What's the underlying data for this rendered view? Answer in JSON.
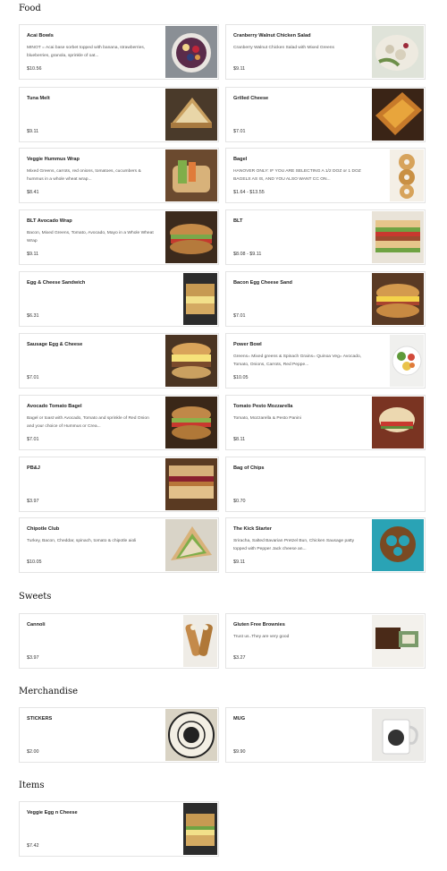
{
  "sections": {
    "food": "Food",
    "sweets": "Sweets",
    "merchandise": "Merchandise",
    "items": "Items"
  },
  "items": {
    "acai": {
      "name": "Acai Bowls",
      "desc": "MINOT = Acai base sorbet topped with banana, strawberries, blueberries, granola, sprinkle of oat...",
      "price": "$10.56"
    },
    "cranberry": {
      "name": "Cranberry Walnut Chicken Salad",
      "desc": "Cranberry Walnut Chicken Salad with Mixed Greens",
      "price": "$9.11"
    },
    "tuna": {
      "name": "Tuna Melt",
      "desc": "",
      "price": "$9.11"
    },
    "grilled": {
      "name": "Grilled Cheese",
      "desc": "",
      "price": "$7.01"
    },
    "hummus": {
      "name": "Veggie Hummus Wrap",
      "desc": "Mixed Greens, carrots, red onions, tomatoes, cucumbers & hummus in a whole wheat wrap...",
      "price": "$8.41"
    },
    "bagel": {
      "name": "Bagel",
      "desc": "HANOVER ONLY: IF YOU ARE SELECTING A 1/2 DOZ or 1 DOZ BAGELS AS IS, AND YOU ALSO WANT CC ON...",
      "price": "$1.64 - $13.55"
    },
    "blt_avocado": {
      "name": "BLT Avocado Wrap",
      "desc": "Bacon, Mixed Greens, Tomato, Avocado, Mayo in a Whole Wheat Wrap",
      "price": "$9.11"
    },
    "blt": {
      "name": "BLT",
      "desc": "",
      "price": "$8.08 - $9.11"
    },
    "egg_cheese": {
      "name": "Egg & Cheese Sandwich",
      "desc": "",
      "price": "$6.31"
    },
    "bacon_egg": {
      "name": "Bacon Egg Cheese Sand",
      "desc": "",
      "price": "$7.01"
    },
    "sausage": {
      "name": "Sausage Egg & Cheese",
      "desc": "",
      "price": "$7.01"
    },
    "power": {
      "name": "Power Bowl",
      "desc": "Greens= Mixed greens & Spinach Grains= Quinoa Veg= Avocado, Tomato, Onions, Carrots, Red Peppe...",
      "price": "$10.05"
    },
    "avocado_bagel": {
      "name": "Avocado Tomato Bagel",
      "desc": "Bagel or toast with Avocado, Tomato and sprinkle of Red Onion and your choice of Hummus or Crea...",
      "price": "$7.01"
    },
    "pesto": {
      "name": "Tomato Pesto Mozzarella",
      "desc": "Tomato, Mozzarella & Pesto Panini",
      "price": "$8.11"
    },
    "pbj": {
      "name": "PB&J",
      "desc": "",
      "price": "$3.97"
    },
    "chips": {
      "name": "Bag of Chips",
      "desc": "",
      "price": "$0.70"
    },
    "chipotle": {
      "name": "Chipotle Club",
      "desc": "Turkey, Bacon, Cheddar, spinach, tomato & chipotle aioli",
      "price": "$10.05"
    },
    "kick": {
      "name": "The Kick Starter",
      "desc": "Sriracha, Salted Bavarian Pretzel Bun, Chicken Sausage patty topped with Pepper Jack cheese an...",
      "price": "$9.11"
    },
    "cannoli": {
      "name": "Cannoli",
      "desc": "",
      "price": "$3.97"
    },
    "brownies": {
      "name": "Gluten Free Brownies",
      "desc": "Trust us..They are very good",
      "price": "$3.27"
    },
    "stickers": {
      "name": "STICKERS",
      "desc": "",
      "price": "$2.00"
    },
    "mug": {
      "name": "MUG",
      "desc": "",
      "price": "$9.90"
    },
    "veggie_egg": {
      "name": "Veggie Egg n Cheese",
      "desc": "",
      "price": "$7.42"
    }
  },
  "colors": {
    "card_border": "#e4e4e4",
    "text_primary": "#222222",
    "text_secondary": "#555555"
  }
}
